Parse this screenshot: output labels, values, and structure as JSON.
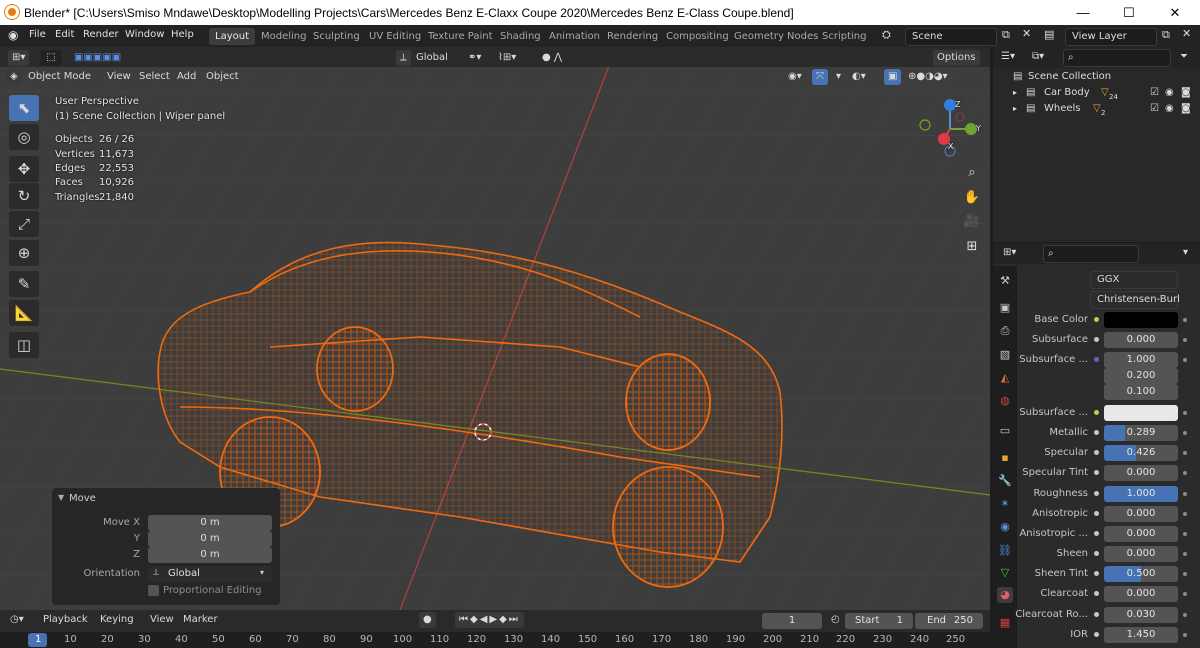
{
  "window": {
    "title": "Blender* [C:\\Users\\Smiso Mndawe\\Desktop\\Modelling Projects\\Cars\\Mercedes Benz E-Claxx Coupe 2020\\Mercedes Benz E-Class Coupe.blend]",
    "minimize": "—",
    "maximize": "☐",
    "close": "✕"
  },
  "menu": {
    "items": [
      "File",
      "Edit",
      "Render",
      "Window",
      "Help"
    ]
  },
  "workspaces": [
    "Layout",
    "Modeling",
    "Sculpting",
    "UV Editing",
    "Texture Paint",
    "Shading",
    "Animation",
    "Rendering",
    "Compositing",
    "Geometry Nodes",
    "Scripting"
  ],
  "scene": {
    "label": "Scene"
  },
  "view_layer": {
    "label": "View Layer"
  },
  "viewport": {
    "mode": "Object Mode",
    "menus": [
      "View",
      "Select",
      "Add",
      "Object"
    ],
    "orientation": "Global",
    "options": "Options",
    "perspective": "User Perspective",
    "collection": "(1) Scene Collection | Wiper panel",
    "stats": [
      {
        "label": "Objects",
        "value": "26 / 26"
      },
      {
        "label": "Vertices",
        "value": "11,673"
      },
      {
        "label": "Edges",
        "value": "22,553"
      },
      {
        "label": "Faces",
        "value": "10,926"
      },
      {
        "label": "Triangles",
        "value": "21,840"
      }
    ],
    "gizmo": {
      "z": "Z",
      "y": "Y",
      "x": "X"
    }
  },
  "move_panel": {
    "title": "Move",
    "fields": [
      {
        "label": "Move X",
        "value": "0 m"
      },
      {
        "label": "Y",
        "value": "0 m"
      },
      {
        "label": "Z",
        "value": "0 m"
      }
    ],
    "orientation_label": "Orientation",
    "orientation_value": "Global",
    "proportional": "Proportional Editing"
  },
  "outliner": {
    "root": "Scene Collection",
    "items": [
      {
        "label": "Car Body",
        "badge": "24"
      },
      {
        "label": "Wheels",
        "badge": "2"
      }
    ]
  },
  "properties": {
    "distribution": "GGX",
    "subsurface_method": "Christensen-Burl",
    "rows": [
      {
        "label": "Base Color",
        "type": "color",
        "color": "#000000"
      },
      {
        "label": "Subsurface",
        "value": "0.000",
        "fill": 0
      },
      {
        "label": "Subsurface ...",
        "value": "1.000",
        "fill": 0
      },
      {
        "label": "",
        "value": "0.200",
        "fill": 0
      },
      {
        "label": "",
        "value": "0.100",
        "fill": 0
      },
      {
        "label": "Subsurface ...",
        "type": "color",
        "color": "#e8e8e8"
      },
      {
        "label": "Metallic",
        "value": "0.289",
        "fill": 0.289
      },
      {
        "label": "Specular",
        "value": "0.426",
        "fill": 0.426
      },
      {
        "label": "Specular Tint",
        "value": "0.000",
        "fill": 0
      },
      {
        "label": "Roughness",
        "value": "1.000",
        "fill": 1.0
      },
      {
        "label": "Anisotropic",
        "value": "0.000",
        "fill": 0
      },
      {
        "label": "Anisotropic ...",
        "value": "0.000",
        "fill": 0
      },
      {
        "label": "Sheen",
        "value": "0.000",
        "fill": 0
      },
      {
        "label": "Sheen Tint",
        "value": "0.500",
        "fill": 0.5
      },
      {
        "label": "Clearcoat",
        "value": "0.000",
        "fill": 0
      },
      {
        "label": "Clearcoat Ro...",
        "value": "0.030",
        "fill": 0
      },
      {
        "label": "IOR",
        "value": "1.450",
        "fill": 0
      }
    ]
  },
  "timeline": {
    "menus": [
      "Playback",
      "Keying",
      "View",
      "Marker"
    ],
    "current_frame": "1",
    "start_label": "Start",
    "start": "1",
    "end_label": "End",
    "end": "250",
    "ticks": [
      "1",
      "10",
      "20",
      "30",
      "40",
      "50",
      "60",
      "70",
      "80",
      "90",
      "100",
      "110",
      "120",
      "130",
      "140",
      "150",
      "160",
      "170",
      "180",
      "190",
      "200",
      "210",
      "220",
      "230",
      "240",
      "250"
    ]
  }
}
